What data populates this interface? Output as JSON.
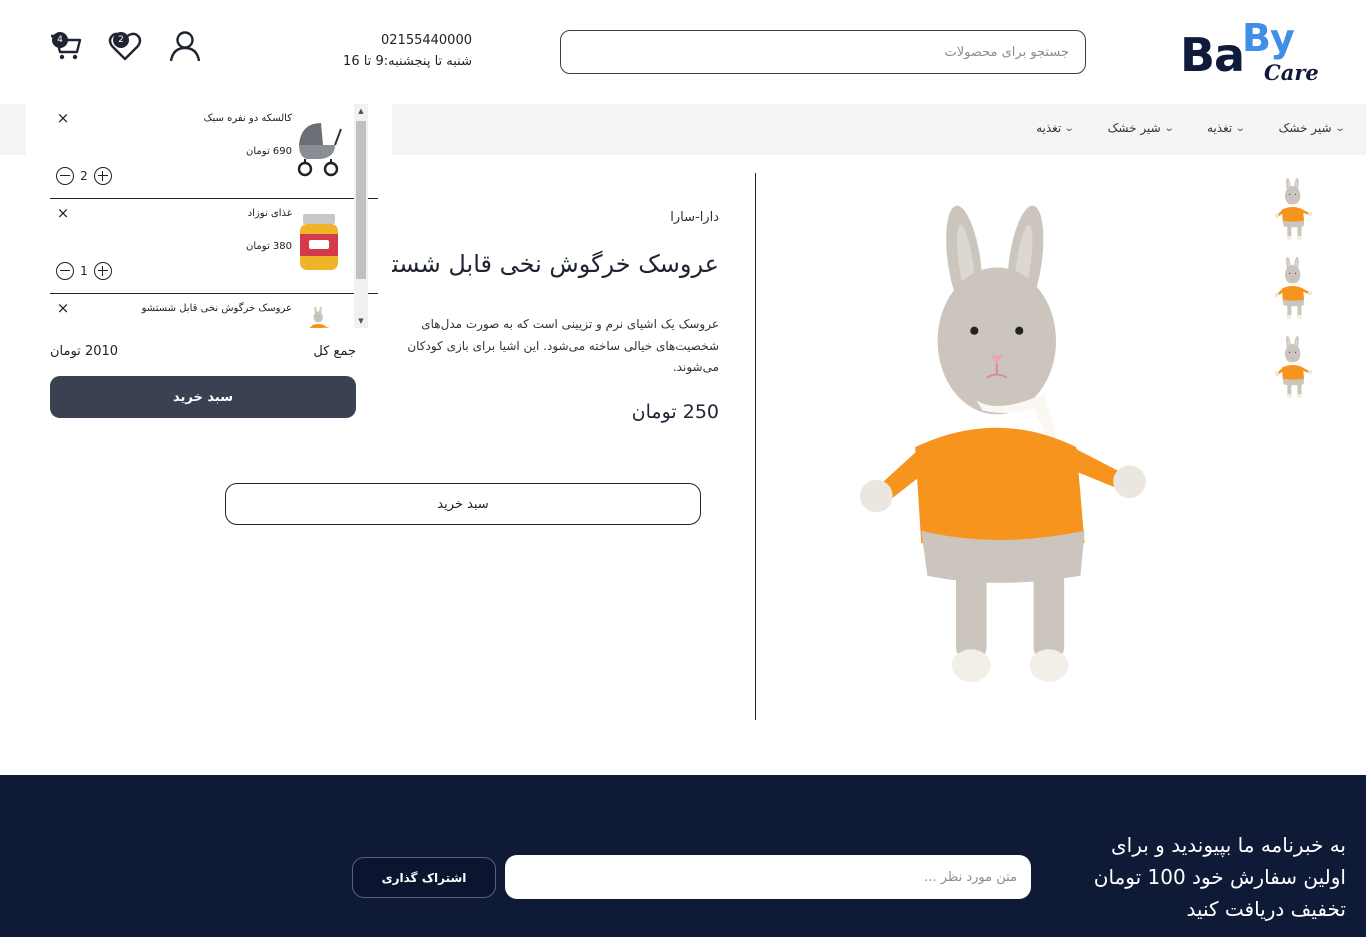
{
  "header": {
    "logo": {
      "ba": "Ba",
      "by": "By",
      "care": "Care"
    },
    "search_placeholder": "جستجو برای محصولات",
    "phone": "02155440000",
    "hours": "شنبه تا پنجشنبه:9 تا 16",
    "wishlist_count": "2",
    "cart_count": "4",
    "icons": [
      "user-icon",
      "heart-icon",
      "cart-icon"
    ]
  },
  "nav": {
    "items": [
      {
        "label": "شیر خشک"
      },
      {
        "label": "تغذیه"
      },
      {
        "label": "شیر خشک"
      },
      {
        "label": "تغذیه"
      }
    ],
    "chevron": "⌄"
  },
  "product": {
    "brand": "دارا-سارا",
    "title": "عروسک خرگوش نخی قابل شستشو",
    "description": [
      "عروسک یک اشیای نرم و تزیینی است که به صورت مدل‌های",
      "شخصیت‌های خیالی ساخته می‌شود. این اشیا برای بازی کودکان",
      "می‌شوند."
    ],
    "price": "250 تومان",
    "buy_label": "سبد خرید"
  },
  "cart": {
    "items": [
      {
        "name": "کالسکه دو نفره سبک",
        "price": "690 تومان",
        "qty": "2",
        "image": "stroller"
      },
      {
        "name": "غذای نوزاد",
        "price": "380 تومان",
        "qty": "1",
        "image": "baby-food-jar"
      },
      {
        "name": "عروسک خرگوش نخی قابل شستشو",
        "price": "",
        "qty": "",
        "image": "bunny-doll"
      }
    ],
    "total_label": "جمع کل",
    "total_value": "2010 تومان",
    "checkout_label": "سبد خرید",
    "close_glyph": "×"
  },
  "footer": {
    "newsletter_text": "به خبرنامه ما بپیوندید و برای اولین سفارش خود 100 تومان تخفیف دریافت کنید",
    "input_placeholder": "متن مورد نظر ...",
    "subscribe_label": "اشتراک گذاری"
  },
  "colors": {
    "brand_navy": "#101b3b",
    "brand_blue": "#3f8fe6",
    "footer_bg": "#0e1a36",
    "checkout_bg": "#3a4150",
    "bunny_orange": "#f7941d"
  }
}
